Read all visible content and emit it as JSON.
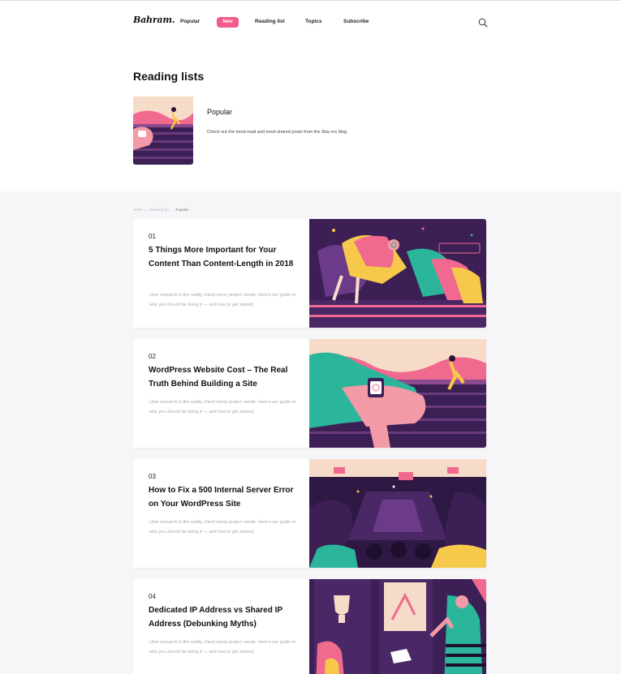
{
  "header": {
    "logo": "Bahram.",
    "nav": {
      "popular": "Popular",
      "new": "New",
      "reading_list": "Reading list",
      "topics": "Topics",
      "subscribe": "Subscribe"
    }
  },
  "reading_lists": {
    "title": "Reading lists",
    "item": {
      "name": "Popular",
      "description": "Check out the most-read and most-shared posts from the 3lay ers blog."
    }
  },
  "breadcrumb": {
    "home": "Home",
    "reading_list": "Reading list",
    "current": "Popular",
    "separator": "→"
  },
  "posts": [
    {
      "number": "01",
      "title": "5 Things More Important for Your Content Than Content-Length in 2018",
      "description": "User research is the reality check every project needs. Here's our guide to why you should be doing it — and how to get started."
    },
    {
      "number": "02",
      "title": "WordPress Website Cost – The Real Truth Behind Building a Site",
      "description": "User research is the reality check every project needs. Here's our guide to why you should be doing it — and how to get started."
    },
    {
      "number": "03",
      "title": "How to Fix a 500 Internal Server Error on Your WordPress Site",
      "description": "User research is the reality check every project needs. Here's our guide to why you should be doing it — and how to get started."
    },
    {
      "number": "04",
      "title": "Dedicated IP Address vs Shared IP Address (Debunking Myths)",
      "description": "User research is the reality check every project needs. Here's our guide to why you should be doing it — and how to get started."
    }
  ],
  "colors": {
    "accent": "#f25b8a",
    "illustration_dark": "#3b1f55",
    "illustration_pink": "#f06a8f",
    "illustration_yellow": "#f7c94b",
    "illustration_teal": "#2bb59a"
  },
  "icons": {
    "search": "search-icon"
  }
}
